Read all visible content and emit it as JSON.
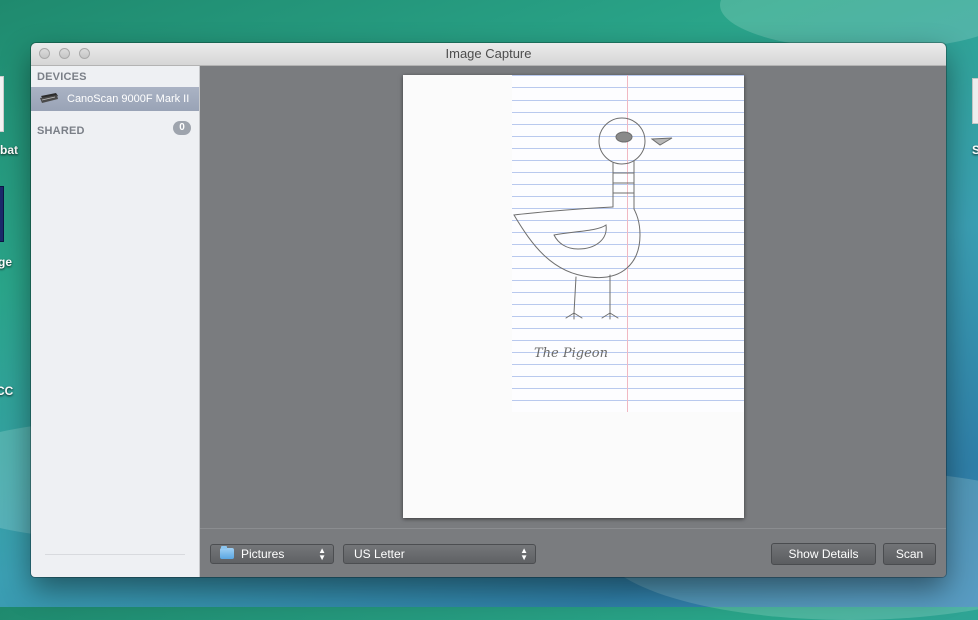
{
  "desktop": {
    "icons": [
      {
        "label": "bat",
        "icon": "acrobat-file-icon"
      },
      {
        "label": "ge",
        "icon": "image-file-icon"
      },
      {
        "label": "CC",
        "icon": "creative-cloud-icon"
      },
      {
        "label": "S",
        "icon": "alias-file-icon"
      }
    ]
  },
  "window": {
    "title": "Image Capture",
    "controls": [
      "close-icon",
      "minimize-icon",
      "zoom-icon"
    ]
  },
  "sidebar": {
    "devices_header": "DEVICES",
    "devices": [
      {
        "label": "CanoScan 9000F Mark II",
        "icon": "scanner-icon",
        "selected": true
      }
    ],
    "shared_header": "SHARED",
    "shared_count": "0"
  },
  "preview": {
    "image": "scanned-pigeon-drawing",
    "handwriting": "The Pigeon"
  },
  "toolbar": {
    "destination": {
      "value": "Pictures",
      "icon": "folder-icon"
    },
    "paper_size": {
      "value": "US Letter"
    },
    "show_details_label": "Show Details",
    "scan_label": "Scan"
  },
  "colors": {
    "selection": "#9fa9bb",
    "preview_bg": "#7a7c7f",
    "sidebar_bg": "#eef0f3"
  }
}
